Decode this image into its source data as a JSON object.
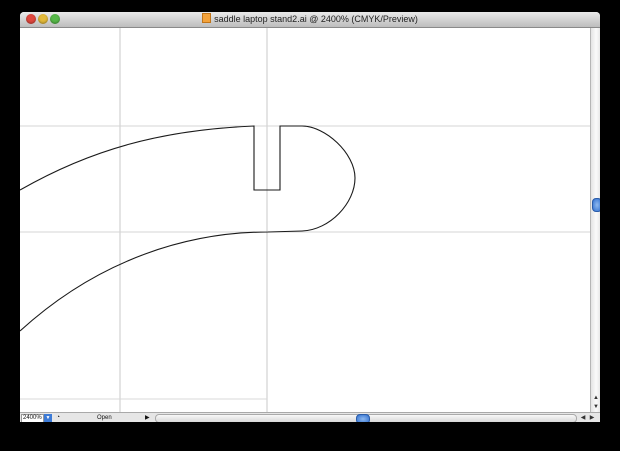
{
  "window": {
    "title": "saddle laptop stand2.ai @ 2400% (CMYK/Preview)"
  },
  "statusbar": {
    "zoom_value": "2400%",
    "status_text": "Open"
  },
  "icons": {
    "window_close": "close-circle",
    "window_minimize": "minimize-circle",
    "window_zoom": "zoom-circle",
    "document": "document-icon"
  },
  "colors": {
    "guide": "#c8c8c8",
    "path_stroke": "#1a1a1a",
    "scroll_thumb": "#2f6fd0"
  }
}
